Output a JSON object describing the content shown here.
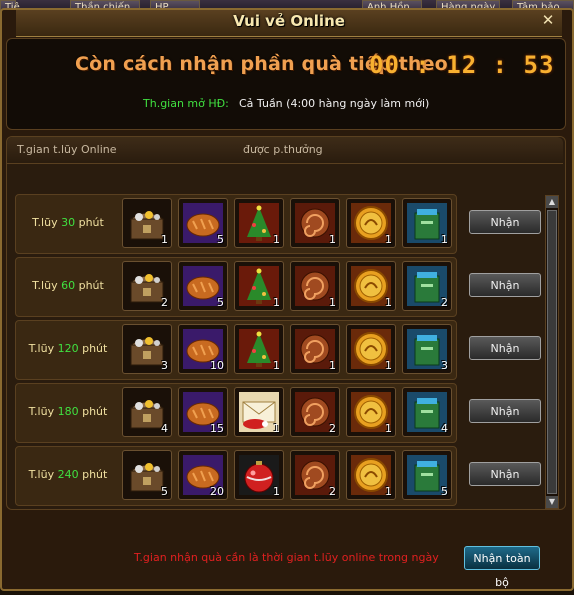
{
  "top_tabs": [
    "Tiệ",
    "Thần chiến",
    "HP",
    "Anh Hồn",
    "Hàng ngày",
    "Tâm bảo"
  ],
  "window": {
    "title": "Vui vẻ Online",
    "close_label": "✕"
  },
  "countdown": {
    "label": "Còn cách nhận phần quà tiếp theo",
    "time": "00 : 12 : 53",
    "open_label": "Th.gian mở HĐ:",
    "open_value": "Cả Tuần (4:00 hàng ngày làm mới)"
  },
  "table": {
    "col_time": "T.gian t.lũy Online",
    "col_reward": "được p.thưởng",
    "rows": [
      {
        "prefix": "T.lũy ",
        "minutes": "30",
        "suffix": " phút",
        "button": "Nhận",
        "items": [
          {
            "icon": "treasure-chest-icon",
            "qty": "1"
          },
          {
            "icon": "bread-icon",
            "qty": "5"
          },
          {
            "icon": "christmas-tree-icon",
            "qty": "1"
          },
          {
            "icon": "scroll-roll-icon",
            "qty": "1"
          },
          {
            "icon": "gold-coin-icon",
            "qty": "1"
          },
          {
            "icon": "green-book-icon",
            "qty": "1"
          }
        ]
      },
      {
        "prefix": "T.lũy ",
        "minutes": "60",
        "suffix": " phút",
        "button": "Nhận",
        "items": [
          {
            "icon": "treasure-chest-icon",
            "qty": "2"
          },
          {
            "icon": "bread-icon",
            "qty": "5"
          },
          {
            "icon": "christmas-tree-icon",
            "qty": "1"
          },
          {
            "icon": "scroll-roll-icon",
            "qty": "1"
          },
          {
            "icon": "gold-coin-icon",
            "qty": "1"
          },
          {
            "icon": "green-book-icon",
            "qty": "2"
          }
        ]
      },
      {
        "prefix": "T.lũy ",
        "minutes": "120",
        "suffix": " phút",
        "button": "Nhận",
        "items": [
          {
            "icon": "treasure-chest-icon",
            "qty": "3"
          },
          {
            "icon": "bread-icon",
            "qty": "10"
          },
          {
            "icon": "christmas-tree-icon",
            "qty": "1"
          },
          {
            "icon": "scroll-roll-icon",
            "qty": "1"
          },
          {
            "icon": "gold-coin-icon",
            "qty": "1"
          },
          {
            "icon": "green-book-icon",
            "qty": "3"
          }
        ]
      },
      {
        "prefix": "T.lũy ",
        "minutes": "180",
        "suffix": " phút",
        "button": "Nhận",
        "items": [
          {
            "icon": "treasure-chest-icon",
            "qty": "4"
          },
          {
            "icon": "bread-icon",
            "qty": "15"
          },
          {
            "icon": "envelope-hat-icon",
            "qty": "1"
          },
          {
            "icon": "scroll-roll-icon",
            "qty": "2"
          },
          {
            "icon": "gold-coin-icon",
            "qty": "1"
          },
          {
            "icon": "green-book-icon",
            "qty": "4"
          }
        ]
      },
      {
        "prefix": "T.lũy ",
        "minutes": "240",
        "suffix": " phút",
        "button": "Nhận",
        "items": [
          {
            "icon": "treasure-chest-icon",
            "qty": "5"
          },
          {
            "icon": "bread-icon",
            "qty": "20"
          },
          {
            "icon": "ornament-ball-icon",
            "qty": "1"
          },
          {
            "icon": "scroll-roll-icon",
            "qty": "2"
          },
          {
            "icon": "gold-coin-icon",
            "qty": "1"
          },
          {
            "icon": "green-book-icon",
            "qty": "5"
          }
        ]
      }
    ]
  },
  "footer": {
    "note": "T.gian nhận quà cần là thời gian t.lũy online trong ngày",
    "claim_all": "Nhận toàn bộ"
  }
}
